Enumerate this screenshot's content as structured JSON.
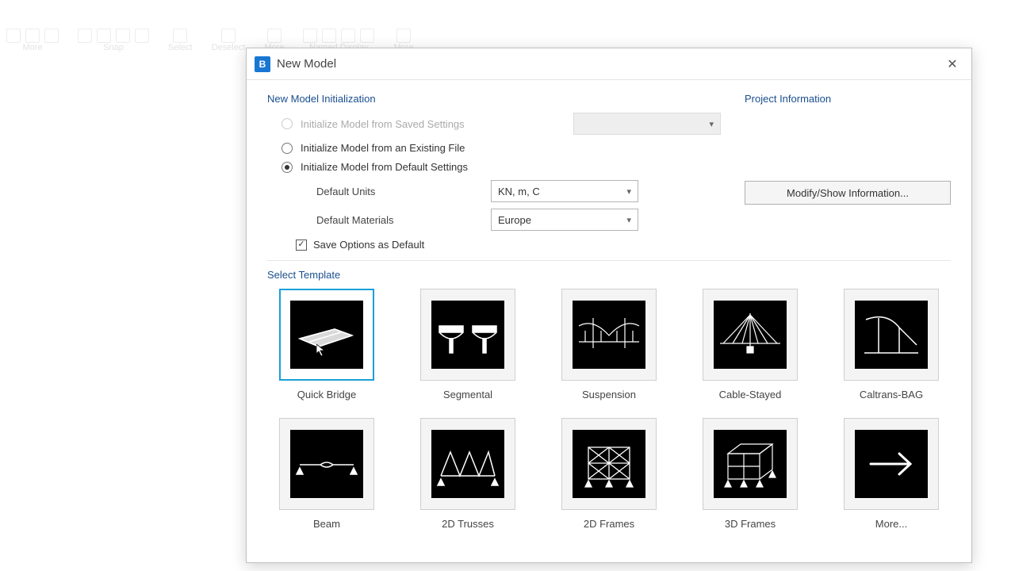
{
  "ribbon": {
    "groups": [
      "More",
      "Snap",
      "Select",
      "Deselect",
      "More",
      "Named Display",
      "More"
    ]
  },
  "modal": {
    "app_icon_letter": "B",
    "title": "New Model",
    "close_glyph": "✕",
    "init": {
      "section_title": "New Model Initialization",
      "opt_saved": "Initialize Model from Saved Settings",
      "opt_existing": "Initialize Model from an Existing File",
      "opt_default": "Initialize Model from Default Settings",
      "default_units_label": "Default Units",
      "default_units_value": "KN, m, C",
      "default_materials_label": "Default Materials",
      "default_materials_value": "Europe",
      "save_options": "Save Options as Default"
    },
    "project": {
      "section_title": "Project Information",
      "modify_btn": "Modify/Show Information..."
    },
    "templates": {
      "section_title": "Select Template",
      "items": [
        {
          "label": "Quick Bridge"
        },
        {
          "label": "Segmental"
        },
        {
          "label": "Suspension"
        },
        {
          "label": "Cable-Stayed"
        },
        {
          "label": "Caltrans-BAG"
        },
        {
          "label": "Beam"
        },
        {
          "label": "2D Trusses"
        },
        {
          "label": "2D Frames"
        },
        {
          "label": "3D Frames"
        },
        {
          "label": "More..."
        }
      ]
    }
  }
}
